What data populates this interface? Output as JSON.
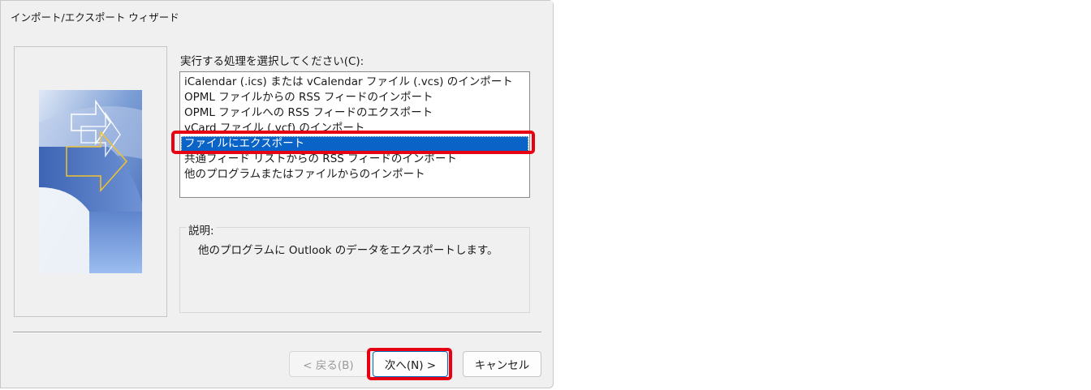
{
  "window": {
    "title": "インポート/エクスポート ウィザード"
  },
  "main": {
    "prompt": "実行する処理を選択してください(C):",
    "actions": [
      "iCalendar (.ics) または vCalendar ファイル (.vcs) のインポート",
      "OPML ファイルからの RSS フィードのインポート",
      "OPML ファイルへの RSS フィードのエクスポート",
      "vCard ファイル (.vcf) のインポート",
      "ファイルにエクスポート",
      "共通フィード リストからの RSS フィードのインポート",
      "他のプログラムまたはファイルからのインポート"
    ],
    "selected_index": 4,
    "description_label": "説明:",
    "description_text": "他のプログラムに Outlook のデータをエクスポートします。"
  },
  "footer": {
    "back_label": "< 戻る(B)",
    "next_label": "次へ(N) >",
    "cancel_label": "キャンセル"
  },
  "colors": {
    "selection": "#0a64c8",
    "annotation": "#e60012",
    "dialog_bg": "#f0f0f0"
  }
}
